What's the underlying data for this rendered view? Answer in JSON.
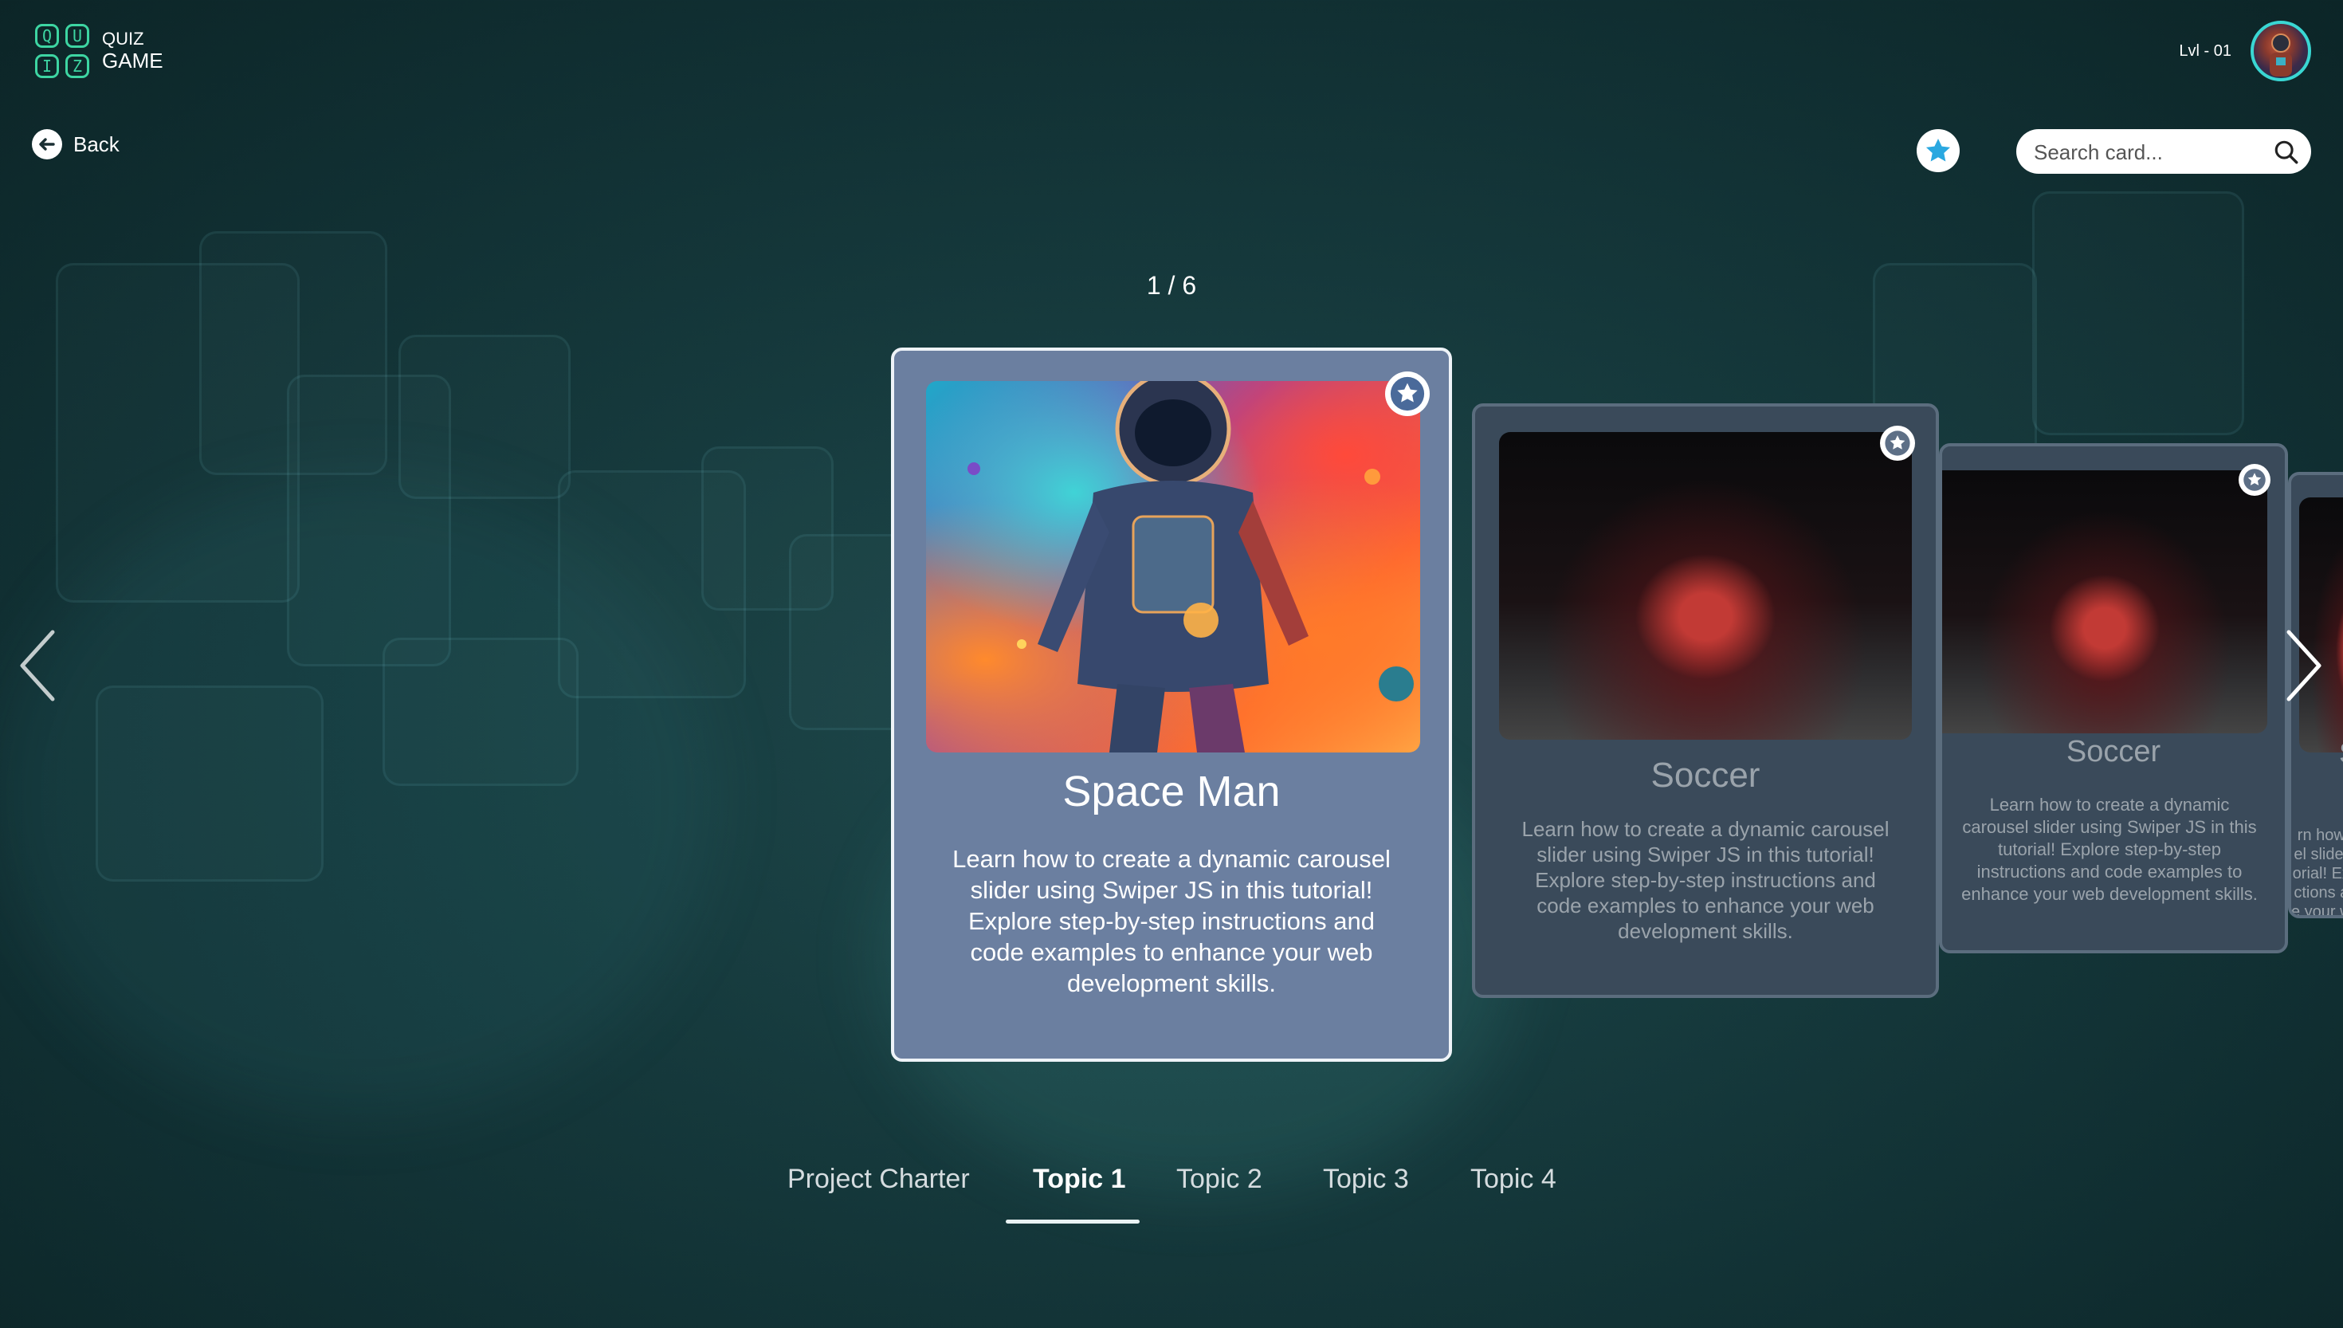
{
  "logo": {
    "letters": [
      "Q",
      "U",
      "I",
      "Z"
    ],
    "line1": "QUIZ",
    "line2": "GAME"
  },
  "user": {
    "level": "Lvl - 01",
    "avatar_icon": "astronaut-avatar"
  },
  "nav": {
    "back_label": "Back"
  },
  "toolbar": {
    "favorite_icon": "star-icon",
    "search_placeholder": "Search card..."
  },
  "carousel": {
    "counter": "1 / 6",
    "cards": [
      {
        "title": "Space Man",
        "description": "Learn how to create a dynamic carousel slider using Swiper JS in this tutorial! Explore step-by-step instructions and code examples to enhance your web development skills.",
        "image": "astronaut-illustration"
      },
      {
        "title": "Soccer",
        "description": "Learn how to create a dynamic carousel slider using Swiper JS in this tutorial! Explore step-by-step instructions and code examples to enhance your web development skills.",
        "image": "red-sports-car-photo"
      },
      {
        "title": "Soccer",
        "desc_lines": [
          "Learn how to create a dynamic",
          "carousel slider using Swiper JS in this",
          "tutorial! Explore step-by-step",
          "instructions and code examples to",
          "enhance your web development skills."
        ],
        "image": "red-sports-car-photo"
      },
      {
        "title_fragment": "S",
        "desc_lines": [
          "rn how",
          "el slider",
          "orial! Ex",
          "ctions a",
          "e your w"
        ]
      }
    ]
  },
  "tabs": [
    {
      "label": "Project Charter",
      "active": false
    },
    {
      "label": "Topic 1",
      "active": true
    },
    {
      "label": "Topic 2",
      "active": false
    },
    {
      "label": "Topic 3",
      "active": false
    },
    {
      "label": "Topic 4",
      "active": false
    }
  ],
  "colors": {
    "accent": "#3dd5a2",
    "star_blue": "#2aa8e0",
    "background": "#163a3d"
  }
}
